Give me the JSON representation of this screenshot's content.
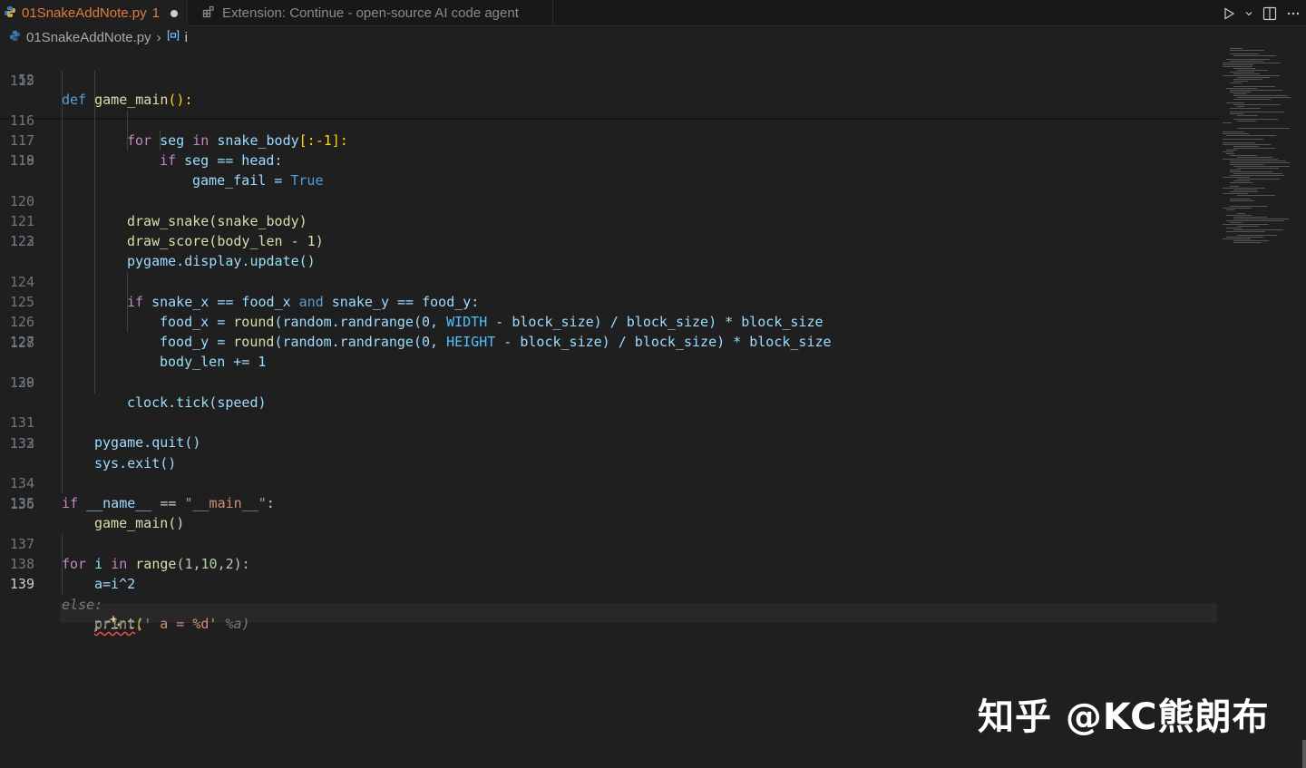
{
  "tabs": [
    {
      "label": "01SnakeAddNote.py",
      "problem_count": "1",
      "dirty": true,
      "icon": "python-icon"
    },
    {
      "label": "Extension: Continue - open-source AI code agent",
      "icon": "extensions-icon"
    }
  ],
  "breadcrumb": {
    "file": "01SnakeAddNote.py",
    "symbol": "i"
  },
  "editor": {
    "current_line": "139",
    "line_numbers": [
      "52",
      "115",
      "116",
      "117",
      "118",
      "119",
      "120",
      "121",
      "122",
      "123",
      "124",
      "125",
      "126",
      "127",
      "128",
      "129",
      "130",
      "131",
      "132",
      "133",
      "134",
      "135",
      "136",
      "137",
      "138",
      "139"
    ],
    "sticky": {
      "kw": "def",
      "name": "game_main",
      "punct": "():"
    },
    "code": {
      "l116": {
        "for": "for",
        "seg": "seg",
        "in": "in",
        "body": "snake_body",
        "slice": "[:-1]:"
      },
      "l117": {
        "if": "if",
        "rest": "seg == head:"
      },
      "l118": {
        "a": "game_fail = ",
        "b": "True"
      },
      "l120": "draw_snake(snake_body)",
      "l121": "draw_score(body_len - 1)",
      "l122": "pygame.display.update()",
      "l124": {
        "if": "if",
        "a": "snake_x == food_x",
        "and": "and",
        "b": "snake_y == food_y:"
      },
      "l125": {
        "a": "food_x = ",
        "fn": "round",
        "b": "(random.randrange(0, ",
        "c": "WIDTH",
        "d": " - block_size) / block_size) * block_size"
      },
      "l126": {
        "a": "food_y = ",
        "fn": "round",
        "b": "(random.randrange(0, ",
        "c": "HEIGHT",
        "d": " - block_size) / block_size) * block_size"
      },
      "l127": "body_len += 1",
      "l129": "clock.tick(speed)",
      "l131": "pygame.quit()",
      "l132": "sys.exit()",
      "l134": {
        "if": "if",
        "a": "__name__",
        "b": " == ",
        "c": "\"__main__\"",
        "d": ":"
      },
      "l135": "game_main()",
      "l137": {
        "for": "for",
        "a": "i",
        "in": "in",
        "b": "range",
        "c": "(1,10,2):"
      },
      "l138": "a=i^2",
      "l139": {
        "fn": "print",
        "a": "(",
        "b": "' a = %d'",
        "ghost": " %a)"
      },
      "ghost1": "else:",
      "ghost2": "print('"
    }
  },
  "watermark": "知乎 @KC熊朗布"
}
